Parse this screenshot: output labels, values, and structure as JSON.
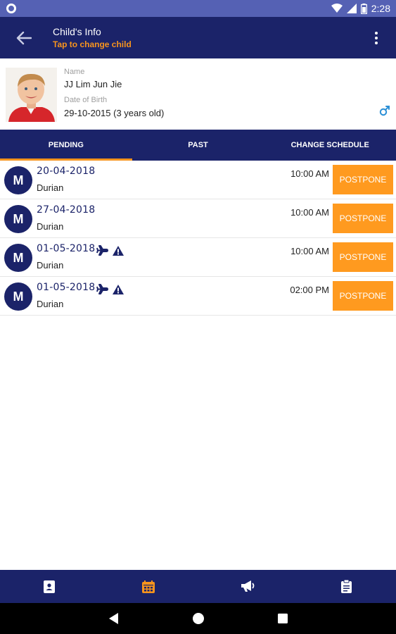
{
  "status_bar": {
    "time": "2:28"
  },
  "app_bar": {
    "title": "Child's Info",
    "subtitle": "Tap to change child"
  },
  "child": {
    "name_label": "Name",
    "name": "JJ Lim Jun Jie",
    "dob_label": "Date of Birth",
    "dob": "29-10-2015 (3 years old)",
    "gender_icon": "male-icon"
  },
  "tabs": [
    {
      "label": "PENDING",
      "active": true
    },
    {
      "label": "PAST",
      "active": false
    },
    {
      "label": "CHANGE SCHEDULE",
      "active": false
    }
  ],
  "appointments": [
    {
      "initial": "M",
      "date": "20-04-2018",
      "name": "Durian",
      "time": "10:00 AM",
      "button": "POSTPONE",
      "icons": []
    },
    {
      "initial": "M",
      "date": "27-04-2018",
      "name": "Durian",
      "time": "10:00 AM",
      "button": "POSTPONE",
      "icons": []
    },
    {
      "initial": "M",
      "date": "01-05-2018",
      "name": "Durian",
      "time": "10:00 AM",
      "button": "POSTPONE",
      "icons": [
        "plane-icon",
        "warning-icon"
      ]
    },
    {
      "initial": "M",
      "date": "01-05-2018",
      "name": "Durian",
      "time": "02:00 PM",
      "button": "POSTPONE",
      "icons": [
        "plane-icon",
        "warning-icon"
      ]
    }
  ],
  "bottom_nav": [
    {
      "icon": "contact-card-icon",
      "active": false
    },
    {
      "icon": "calendar-icon",
      "active": true
    },
    {
      "icon": "megaphone-icon",
      "active": false
    },
    {
      "icon": "clipboard-icon",
      "active": false
    }
  ],
  "colors": {
    "primary": "#1b2369",
    "accent": "#f7941d",
    "button": "#ff9a1f",
    "status_bar": "#5561b4",
    "gender": "#2a8fd6"
  }
}
